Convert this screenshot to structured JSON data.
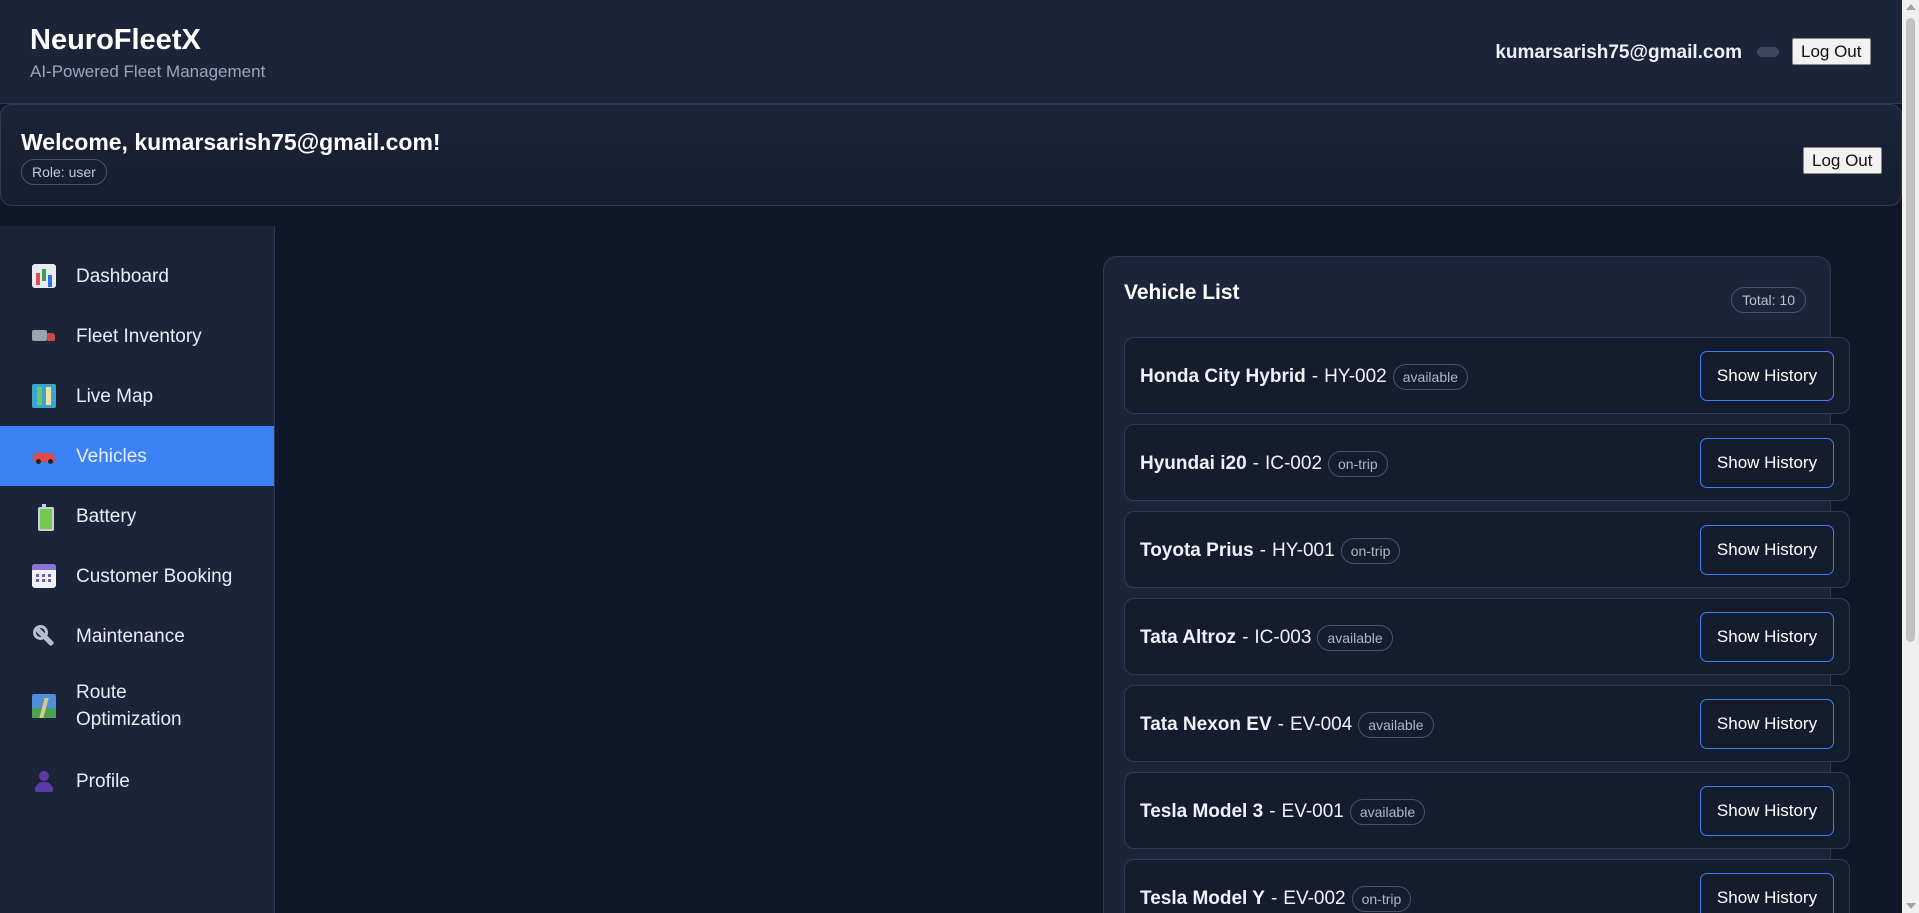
{
  "header": {
    "brand": "NeuroFleetX",
    "tagline": "AI-Powered Fleet Management",
    "user_email": "kumarsarish75@gmail.com",
    "logout_label": "Log Out"
  },
  "welcome": {
    "title": "Welcome, kumarsarish75@gmail.com!",
    "role": "Role: user",
    "logout_label": "Log Out"
  },
  "sidebar": {
    "items": [
      {
        "label": "Dashboard",
        "icon": "dashboard-chart-icon"
      },
      {
        "label": "Fleet Inventory",
        "icon": "truck-icon"
      },
      {
        "label": "Live Map",
        "icon": "map-icon"
      },
      {
        "label": "Vehicles",
        "icon": "car-icon",
        "active": true
      },
      {
        "label": "Battery",
        "icon": "battery-icon"
      },
      {
        "label": "Customer Booking",
        "icon": "calendar-icon"
      },
      {
        "label": "Maintenance",
        "icon": "wrench-icon"
      },
      {
        "label": "Route Optimization",
        "icon": "route-icon"
      },
      {
        "label": "Profile",
        "icon": "user-icon"
      }
    ]
  },
  "vehicle_list": {
    "title": "Vehicle List",
    "total": "Total: 10",
    "button_label": "Show History",
    "vehicles": [
      {
        "name": "Honda City Hybrid",
        "code": "HY-002",
        "status": "available"
      },
      {
        "name": "Hyundai i20",
        "code": "IC-002",
        "status": "on-trip"
      },
      {
        "name": "Toyota Prius",
        "code": "HY-001",
        "status": "on-trip"
      },
      {
        "name": "Tata Altroz",
        "code": "IC-003",
        "status": "available"
      },
      {
        "name": "Tata Nexon EV",
        "code": "EV-004",
        "status": "available"
      },
      {
        "name": "Tesla Model 3",
        "code": "EV-001",
        "status": "available"
      },
      {
        "name": "Tesla Model Y",
        "code": "EV-002",
        "status": "on-trip"
      }
    ]
  },
  "colors": {
    "accent": "#3b82f6",
    "background": "#101729",
    "surface": "#1b2438"
  }
}
